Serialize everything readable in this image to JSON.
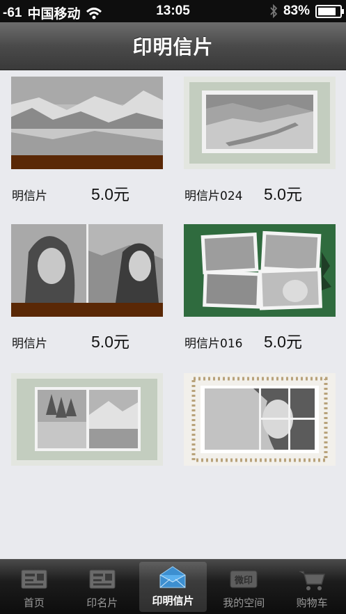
{
  "status_bar": {
    "signal": "-61",
    "carrier": "中国移动",
    "time": "13:05",
    "battery": "83%",
    "icons": [
      "wifi-icon",
      "bluetooth-icon",
      "battery-icon"
    ]
  },
  "nav": {
    "title": "印明信片"
  },
  "products": [
    {
      "name": "明信片",
      "price": "5.0元"
    },
    {
      "name": "明信片024",
      "price": "5.0元"
    },
    {
      "name": "明信片",
      "price": "5.0元"
    },
    {
      "name": "明信片016",
      "price": "5.0元"
    },
    {
      "name": "",
      "price": ""
    },
    {
      "name": "",
      "price": ""
    }
  ],
  "tabs": [
    {
      "label": "首页",
      "icon": "home-card-icon",
      "active": false
    },
    {
      "label": "印名片",
      "icon": "business-card-icon",
      "active": false
    },
    {
      "label": "印明信片",
      "icon": "envelope-icon",
      "active": true
    },
    {
      "label": "我的空间",
      "icon": "weiyin-stamp-icon",
      "icon_text": "微印",
      "active": false
    },
    {
      "label": "购物车",
      "icon": "shopping-cart-icon",
      "active": false
    }
  ]
}
